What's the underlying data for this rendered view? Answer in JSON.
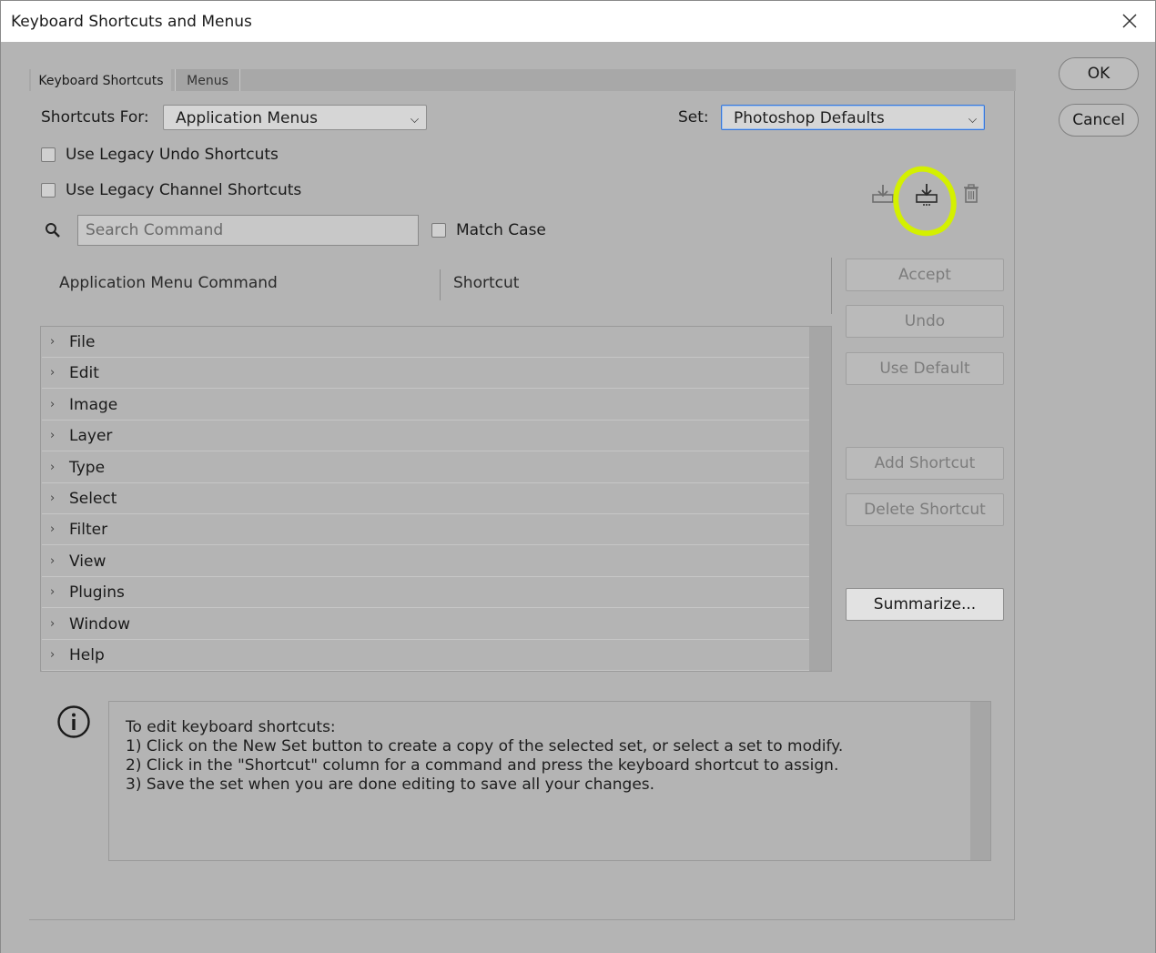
{
  "window": {
    "title": "Keyboard Shortcuts and Menus"
  },
  "tabs": [
    {
      "label": "Keyboard Shortcuts"
    },
    {
      "label": "Menus"
    }
  ],
  "shortcuts_for": {
    "label": "Shortcuts For:",
    "value": "Application Menus"
  },
  "set": {
    "label": "Set:",
    "value": "Photoshop Defaults"
  },
  "options": {
    "legacy_undo": {
      "label": "Use Legacy Undo Shortcuts",
      "checked": false
    },
    "legacy_channel": {
      "label": "Use Legacy Channel Shortcuts",
      "checked": false
    },
    "match_case": {
      "label": "Match Case",
      "checked": false
    }
  },
  "search": {
    "placeholder": "Search Command"
  },
  "icons": {
    "save_set": "save-set-icon",
    "new_set": "new-set-icon",
    "delete_set": "trash-icon",
    "search": "search-icon",
    "info": "info-icon"
  },
  "columns": {
    "command": "Application Menu Command",
    "shortcut": "Shortcut"
  },
  "menu_items": [
    "File",
    "Edit",
    "Image",
    "Layer",
    "Type",
    "Select",
    "Filter",
    "View",
    "Plugins",
    "Window",
    "Help"
  ],
  "buttons": {
    "accept": "Accept",
    "undo": "Undo",
    "use_default": "Use Default",
    "add_shortcut": "Add Shortcut",
    "delete_shortcut": "Delete Shortcut",
    "summarize": "Summarize...",
    "ok": "OK",
    "cancel": "Cancel"
  },
  "info": {
    "lines": [
      "To edit keyboard shortcuts:",
      "1) Click on the New Set button to create a copy of the selected set, or select a set to modify.",
      "2) Click in the \"Shortcut\" column for a command and press the keyboard shortcut to assign.",
      "3) Save the set when you are done editing to save all your changes."
    ]
  },
  "colors": {
    "annotation": "#d4f000",
    "focus_border": "#3b78d8"
  }
}
